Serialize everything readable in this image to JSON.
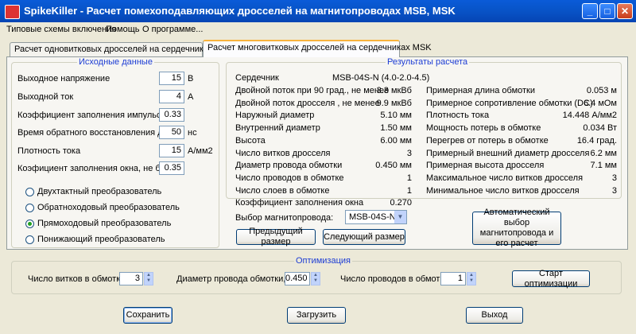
{
  "window": {
    "title": "SpikeKiller - Расчет помехоподавляющих дросселей на магнитопроводах MSB, MSK"
  },
  "menu": [
    "Типовые схемы включения",
    "Помощь",
    "О программе..."
  ],
  "tabs": [
    "Расчет одновитковых дросселей на сердечниках MSB",
    "Расчет многовитковых дросселей на сердечниках MSK"
  ],
  "inputs": {
    "title": "Исходные данные",
    "fields": [
      {
        "label": "Выходное напряжение",
        "value": "15",
        "unit": "В"
      },
      {
        "label": "Выходной ток",
        "value": "4",
        "unit": "А"
      },
      {
        "label": "Коэффициент заполнения импульса",
        "value": "0.33",
        "unit": ""
      },
      {
        "label": "Время обратного восстановления диода",
        "value": "50",
        "unit": "нс"
      },
      {
        "label": "Плотность тока",
        "value": "15",
        "unit": "А/мм2"
      },
      {
        "label": "Коэфициент заполнения окна, не более",
        "value": "0.35",
        "unit": ""
      }
    ],
    "converters": [
      {
        "label": "Двухтактный преобразователь",
        "selected": false
      },
      {
        "label": "Обратноходовый преобразователь",
        "selected": false
      },
      {
        "label": "Прямоходовый преобразователь",
        "selected": true
      },
      {
        "label": "Понижающий преобразователь",
        "selected": false
      }
    ]
  },
  "results": {
    "title": "Результаты расчета",
    "core_label": "Сердечник",
    "core_value": "MSB-04S-N (4.0-2.0-4.5)",
    "left": [
      {
        "label": "Двойной поток при 90 град., не менее",
        "value": "3.3 мкВб"
      },
      {
        "label": "Двойной поток дросселя , не менее",
        "value": "9.9 мкВб"
      },
      {
        "label": "Наружный диаметр",
        "value": "5.10 мм"
      },
      {
        "label": "Внутренний диаметр",
        "value": "1.50 мм"
      },
      {
        "label": "Высота",
        "value": "6.00 мм"
      },
      {
        "label": "Число витков дросселя",
        "value": "3"
      },
      {
        "label": "Диаметр провода обмотки",
        "value": "0.450 мм"
      },
      {
        "label": "Число проводов в обмотке",
        "value": "1"
      },
      {
        "label": "Число слоев в обмотке",
        "value": "1"
      },
      {
        "label": "Коэффициент заполнения окна",
        "value": "0.270"
      }
    ],
    "right": [
      {
        "label": "Примерная длина обмотки",
        "value": "0.053 м"
      },
      {
        "label": "Примерное сопротивление обмотки (DC)",
        "value": "6.4 мОм"
      },
      {
        "label": "Плотность тока",
        "value": "14.448 А/мм2"
      },
      {
        "label": "Мощность потерь в обмотке",
        "value": "0.034 Вт"
      },
      {
        "label": "Перегрев от потерь в обмотке",
        "value": "16.4 град."
      },
      {
        "label": "Примерный внешний диаметр дросселя",
        "value": "6.2 мм"
      },
      {
        "label": "Примерная высота дросселя",
        "value": "7.1 мм"
      },
      {
        "label": "Максимальное число витков дросселя",
        "value": "3"
      },
      {
        "label": "Минимальное число витков дросселя",
        "value": "3"
      }
    ],
    "core_select_label": "Выбор магнитопровода:",
    "core_select_value": "MSB-04S-N",
    "prev_button": "Предыдущий размер",
    "next_button": "Следующий размер",
    "auto_button": "Автоматический выбор магнитопровода и его расчет"
  },
  "optimization": {
    "title": "Оптимизация",
    "turns_label": "Число витков в обмотке",
    "turns_value": "3",
    "diameter_label": "Диаметр провода обмотки, мм",
    "diameter_value": "0.450",
    "wires_label": "Число проводов в обмотке",
    "wires_value": "1",
    "start_button": "Старт оптимизации"
  },
  "bottom": {
    "save": "Сохранить",
    "load": "Загрузить",
    "exit": "Выход"
  }
}
